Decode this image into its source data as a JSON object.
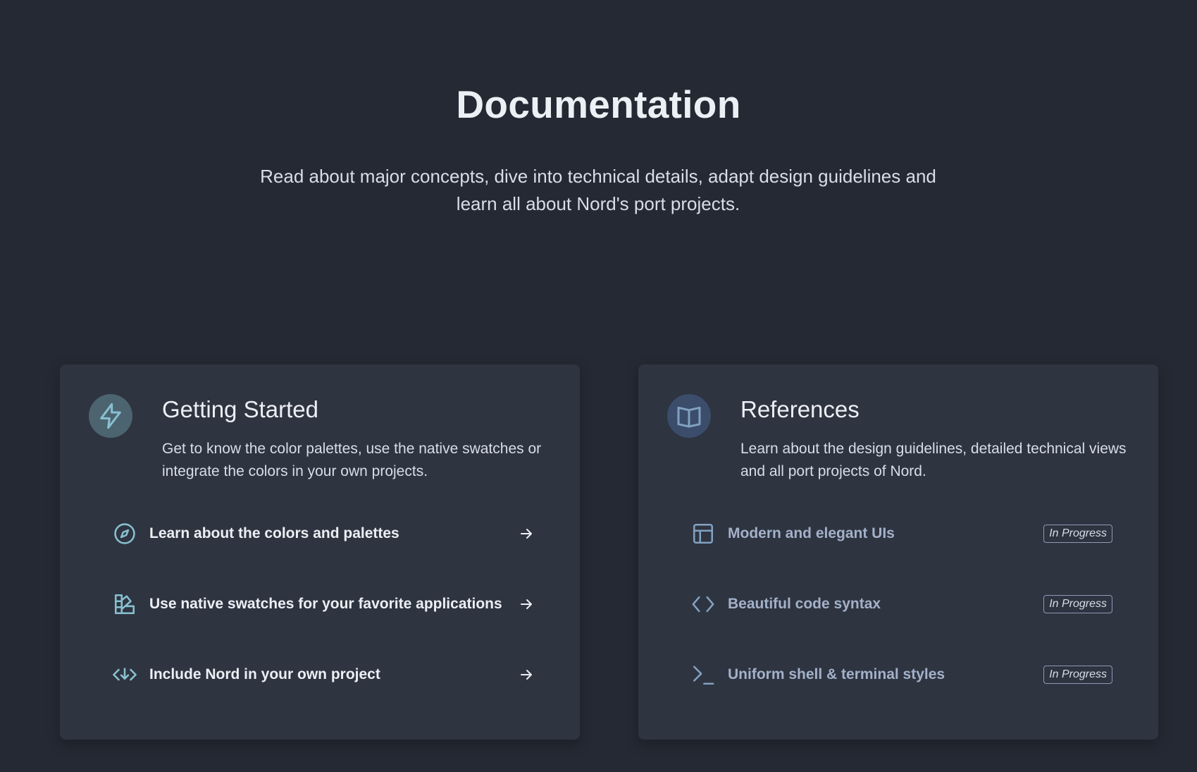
{
  "header": {
    "title": "Documentation",
    "subtitle": "Read about major concepts, dive into technical details, adapt design guidelines and learn all about Nord's port projects."
  },
  "cards": [
    {
      "title": "Getting Started",
      "description": "Get to know the color palettes, use the native swatches or integrate the colors in your own projects.",
      "icon": "lightning-icon",
      "links": [
        {
          "label": "Learn about the colors and palettes",
          "icon": "compass-icon",
          "action": "arrow-right-icon"
        },
        {
          "label": "Use native swatches for your favorite applications",
          "icon": "swatches-icon",
          "action": "arrow-right-icon"
        },
        {
          "label": "Include Nord in your own project",
          "icon": "code-download-icon",
          "action": "arrow-right-icon"
        }
      ]
    },
    {
      "title": "References",
      "description": "Learn about the design guidelines, detailed technical views and all port projects of Nord.",
      "icon": "book-icon",
      "links": [
        {
          "label": "Modern and elegant UIs",
          "icon": "layout-icon",
          "status": "In Progress"
        },
        {
          "label": "Beautiful code syntax",
          "icon": "code-brackets-icon",
          "status": "In Progress"
        },
        {
          "label": "Uniform shell & terminal styles",
          "icon": "terminal-icon",
          "status": "In Progress"
        }
      ]
    }
  ],
  "colors": {
    "background": "#242933",
    "card": "#2e3440",
    "accent_frost": "#88c0d0",
    "accent_blue": "#81a1c1",
    "muted_text": "#a3b1c9"
  }
}
